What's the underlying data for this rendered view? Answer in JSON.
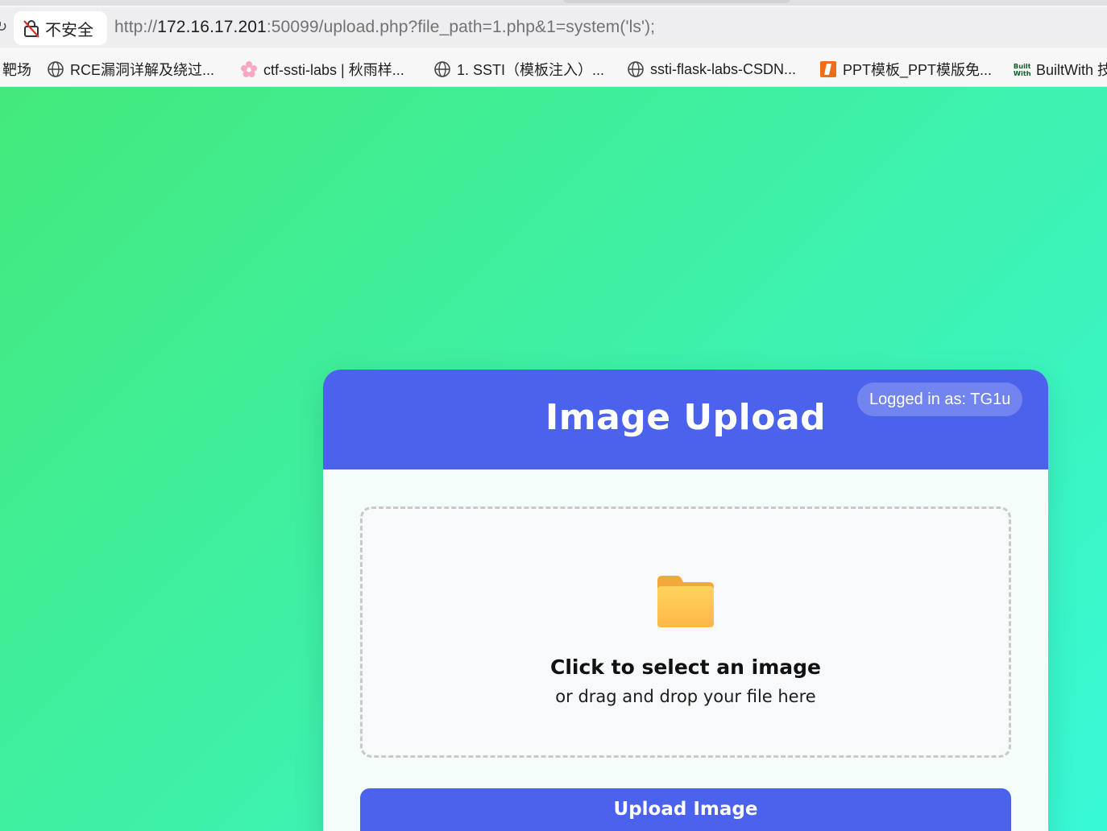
{
  "browser": {
    "security_label": "不安全",
    "url_prefix": "http://",
    "url_host": "172.16.17.201",
    "url_rest": ":50099/upload.php?file_path=1.php&1=system('ls');",
    "bookmarks": [
      {
        "label": "靶场",
        "icon": "none"
      },
      {
        "label": "RCE漏洞详解及绕过...",
        "icon": "globe-icon"
      },
      {
        "label": "ctf-ssti-labs | 秋雨样...",
        "icon": "blossom-icon"
      },
      {
        "label": "1. SSTI（模板注入）...",
        "icon": "globe-icon"
      },
      {
        "label": "ssti-flask-labs-CSDN...",
        "icon": "globe-icon"
      },
      {
        "label": "PPT模板_PPT模版免...",
        "icon": "ppt-icon"
      },
      {
        "label": "BuiltWith 技",
        "icon": "builtwith-icon"
      }
    ]
  },
  "card": {
    "title": "Image Upload",
    "user_badge": "Logged in as: TG1u",
    "dropzone": {
      "icon": "folder-icon",
      "primary": "Click to select an image",
      "secondary": "or drag and drop your file here"
    },
    "upload_button": "Upload Image"
  },
  "colors": {
    "header": "#4a62ec",
    "gradient_start": "#43e97b",
    "gradient_end": "#38f9d7",
    "folder": "#ffc84a"
  }
}
